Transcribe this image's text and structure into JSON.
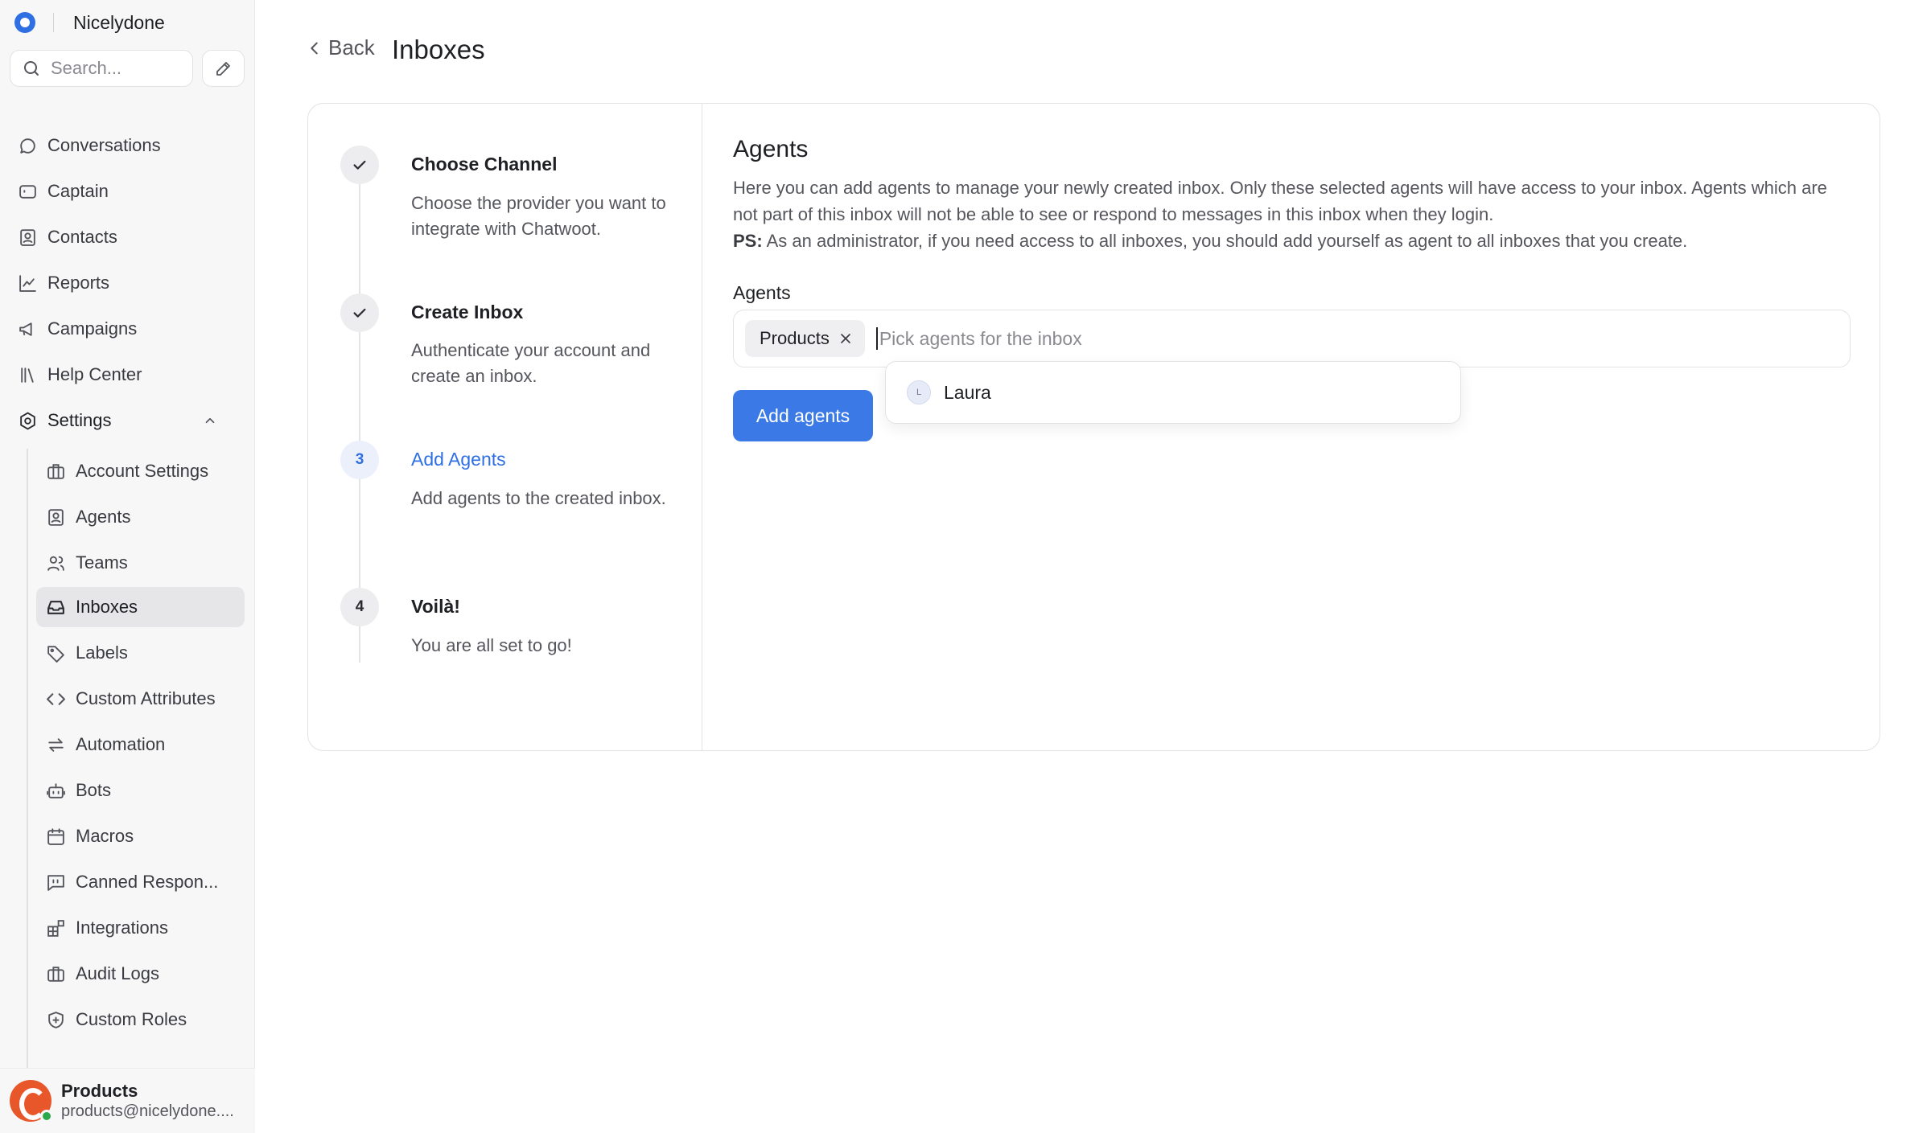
{
  "app": {
    "workspace_name": "Nicelydone"
  },
  "search": {
    "placeholder": "Search..."
  },
  "nav": {
    "conversations": "Conversations",
    "captain": "Captain",
    "contacts": "Contacts",
    "reports": "Reports",
    "campaigns": "Campaigns",
    "help_center": "Help Center",
    "settings": "Settings"
  },
  "settings_items": [
    {
      "label": "Account Settings",
      "icon": "briefcase-icon"
    },
    {
      "label": "Agents",
      "icon": "contact-square-icon"
    },
    {
      "label": "Teams",
      "icon": "users-icon"
    },
    {
      "label": "Inboxes",
      "icon": "inbox-icon"
    },
    {
      "label": "Labels",
      "icon": "tag-icon"
    },
    {
      "label": "Custom Attributes",
      "icon": "code-icon"
    },
    {
      "label": "Automation",
      "icon": "arrows-swap-icon"
    },
    {
      "label": "Bots",
      "icon": "bot-icon"
    },
    {
      "label": "Macros",
      "icon": "calendar-icon"
    },
    {
      "label": "Canned Respon...",
      "icon": "message-square-icon"
    },
    {
      "label": "Integrations",
      "icon": "blocks-icon"
    },
    {
      "label": "Audit Logs",
      "icon": "briefcase-icon"
    },
    {
      "label": "Custom Roles",
      "icon": "shield-icon"
    }
  ],
  "profile": {
    "name": "Products",
    "email": "products@nicelydone...."
  },
  "header": {
    "back_label": "Back",
    "title": "Inboxes"
  },
  "steps": [
    {
      "number": "",
      "title": "Choose Channel",
      "description": "Choose the provider you want to integrate with Chatwoot.",
      "state": "done"
    },
    {
      "number": "",
      "title": "Create Inbox",
      "description": "Authenticate your account and create an inbox.",
      "state": "done"
    },
    {
      "number": "3",
      "title": "Add Agents",
      "description": "Add agents to the created inbox.",
      "state": "current"
    },
    {
      "number": "4",
      "title": "Voilà!",
      "description": "You are all set to go!",
      "state": "upcoming"
    }
  ],
  "agents_panel": {
    "title": "Agents",
    "description": "Here you can add agents to manage your newly created inbox. Only these selected agents will have access to your inbox. Agents which are not part of this inbox will not be able to see or respond to messages in this inbox when they login.",
    "ps_label": "PS:",
    "ps_text": "As an administrator, if you need access to all inboxes, you should add yourself as agent to all inboxes that you create.",
    "field_label": "Agents",
    "selected_tag": "Products",
    "input_placeholder": "Pick agents for the inbox",
    "options": [
      {
        "initial": "L",
        "name": "Laura"
      }
    ],
    "submit_label": "Add agents"
  },
  "colors": {
    "accent": "#3b7ae6",
    "brand": "#2f6fe4",
    "step_active": "#2f6fe4"
  }
}
